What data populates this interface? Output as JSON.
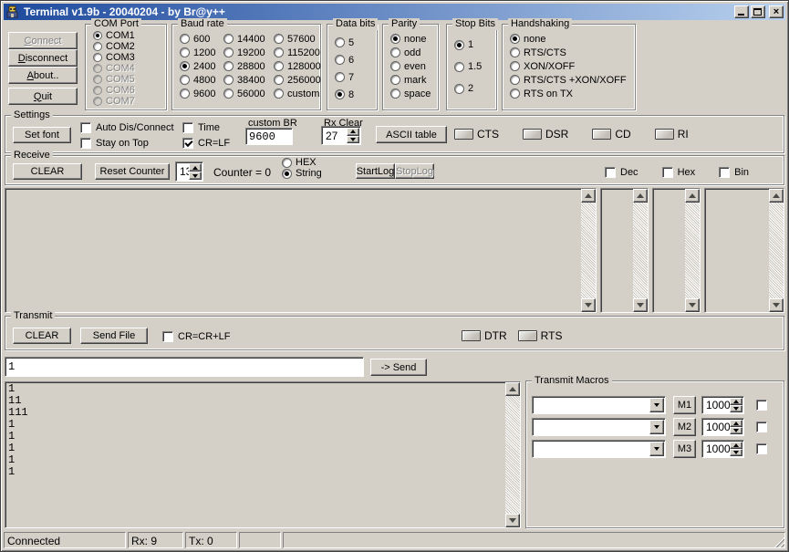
{
  "colors": {
    "titlebar_left": "#1e4a9e",
    "titlebar_right": "#b9d1ee",
    "dialog_bg": "#d4d0c8"
  },
  "window": {
    "title": "Terminal v1.9b - 20040204 - by Br@y++",
    "controls": [
      "minimize",
      "maximize",
      "close"
    ]
  },
  "sidebar_buttons": [
    {
      "label": "Connect",
      "disabled": true
    },
    {
      "label": "Disconnect",
      "disabled": false
    },
    {
      "label": "About..",
      "disabled": false
    },
    {
      "label": "Quit",
      "disabled": false
    }
  ],
  "com_port": {
    "title": "COM Port",
    "selected": "COM1",
    "options": [
      {
        "label": "COM1"
      },
      {
        "label": "COM2"
      },
      {
        "label": "COM3"
      },
      {
        "label": "COM4",
        "disabled": true
      },
      {
        "label": "COM5",
        "disabled": true
      },
      {
        "label": "COM6",
        "disabled": true
      },
      {
        "label": "COM7",
        "disabled": true
      }
    ]
  },
  "baud_rate": {
    "title": "Baud rate",
    "selected": "2400",
    "col1": [
      "600",
      "1200",
      "2400",
      "4800",
      "9600"
    ],
    "col2": [
      "14400",
      "19200",
      "28800",
      "38400",
      "56000"
    ],
    "col3": [
      "57600",
      "115200",
      "128000",
      "256000",
      "custom"
    ]
  },
  "data_bits": {
    "title": "Data bits",
    "selected": "8",
    "options": [
      "5",
      "6",
      "7",
      "8"
    ]
  },
  "parity": {
    "title": "Parity",
    "selected": "none",
    "options": [
      "none",
      "odd",
      "even",
      "mark",
      "space"
    ]
  },
  "stop_bits": {
    "title": "Stop Bits",
    "selected": "1",
    "options": [
      "1",
      "1.5",
      "2"
    ]
  },
  "handshaking": {
    "title": "Handshaking",
    "selected": "none",
    "options": [
      "none",
      "RTS/CTS",
      "XON/XOFF",
      "RTS/CTS +XON/XOFF",
      "RTS on TX"
    ]
  },
  "settings": {
    "title": "Settings",
    "set_font": "Set font",
    "checks_col1": [
      {
        "label": "Auto Dis/Connect",
        "checked": false
      },
      {
        "label": "Stay on Top",
        "checked": false
      }
    ],
    "checks_col2": [
      {
        "label": "Time",
        "checked": false
      },
      {
        "label": "CR=LF",
        "checked": true
      }
    ],
    "custom_br_label": "custom BR",
    "custom_br_value": "9600",
    "rx_clear_label": "Rx Clear",
    "rx_clear_value": "27",
    "ascii_table": "ASCII table",
    "leds": [
      "CTS",
      "DSR",
      "CD",
      "RI"
    ]
  },
  "receive": {
    "title": "Receive",
    "clear": "CLEAR",
    "reset_counter": "Reset Counter",
    "lines_value": "13",
    "counter_text": "Counter = 0",
    "mode_options": [
      "HEX",
      "String"
    ],
    "mode_selected": "String",
    "start_log": {
      "label": "StartLog",
      "disabled": false
    },
    "stop_log": {
      "label": "StopLog",
      "disabled": true
    },
    "view_checks": [
      {
        "label": "Dec",
        "checked": false
      },
      {
        "label": "Hex",
        "checked": false
      },
      {
        "label": "Bin",
        "checked": false
      }
    ]
  },
  "transmit": {
    "title": "Transmit",
    "clear": "CLEAR",
    "send_file": "Send File",
    "crlf_check": {
      "label": "CR=CR+LF",
      "checked": false
    },
    "leds": [
      "DTR",
      "RTS"
    ],
    "input_value": "1",
    "send_button": "-> Send",
    "history": [
      "1",
      "11",
      "111",
      "1",
      "1",
      "1",
      "1",
      "1"
    ]
  },
  "macros": {
    "title": "Transmit Macros",
    "rows": [
      {
        "macro": "",
        "button": "M1",
        "interval": "1000",
        "checked": false
      },
      {
        "macro": "",
        "button": "M2",
        "interval": "1000",
        "checked": false
      },
      {
        "macro": "",
        "button": "M3",
        "interval": "1000",
        "checked": false
      }
    ]
  },
  "status_bar": {
    "panels": [
      "Connected",
      "Rx: 9",
      "Tx: 0",
      "",
      ""
    ]
  }
}
